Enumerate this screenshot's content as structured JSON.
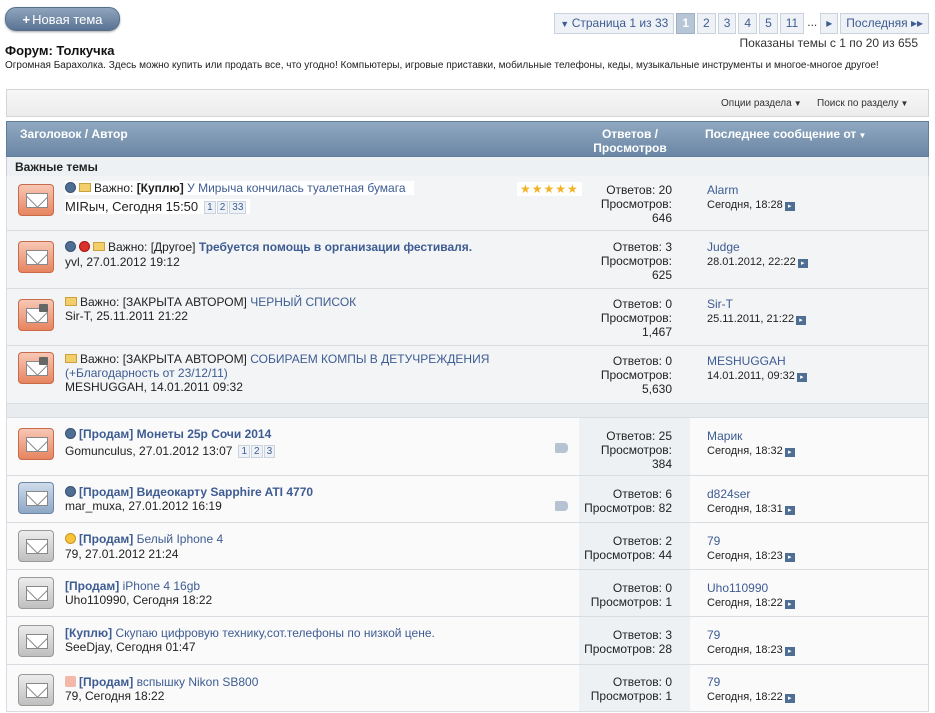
{
  "new_thread_label": "Новая тема",
  "pagenav": {
    "page_of": "Страница 1 из 33",
    "pages": [
      "1",
      "2",
      "3",
      "4",
      "5",
      "11"
    ],
    "dots": "...",
    "next": "▸",
    "last": "Последняя ▸▸"
  },
  "showing": "Показаны темы с 1 по 20 из 655",
  "forum": {
    "title": "Форум: Толкучка",
    "description": "Огромная Барахолка. Здесь можно купить или продать все, что угодно! Компьютеры, игровые приставки, мобильные телефоны, кеды, музыкальные инструменты и многое-многое другое!"
  },
  "options": {
    "section_options": "Опции раздела",
    "search_section": "Поиск по разделу"
  },
  "header": {
    "title_author": "Заголовок / Автор",
    "replies_views": "Ответов / Просмотров",
    "last_post": "Последнее сообщение от"
  },
  "sticky_label": "Важные темы",
  "threads": [
    {
      "prefix": "Важно:",
      "tag": "[Куплю]",
      "title": "У Мирыча кончилась туалетная бумага",
      "author": "MIRыч, Сегодня 15:50",
      "pages": [
        "1",
        "2",
        "33"
      ],
      "replies": "Ответов: 20",
      "views_label": "Просмотров:",
      "views": "646",
      "last_by": "Alarm",
      "last_time": "Сегодня, 18:28",
      "rating": "★★★★★"
    },
    {
      "prefix": "Важно:",
      "tag": "[Другое]",
      "title": "Требуется помощь в организации фестиваля.",
      "author": "yvl, 27.01.2012 19:12",
      "replies": "Ответов: 3",
      "views_label": "Просмотров:",
      "views": "625",
      "last_by": "Judge",
      "last_time": "28.01.2012, 22:22"
    },
    {
      "prefix": "Важно:",
      "tag": "[ЗАКРЫТА АВТОРОМ]",
      "title": "ЧЕРНЫЙ СПИСОК",
      "author": "Sir-T, 25.11.2011 21:22",
      "replies": "Ответов: 0",
      "views_label": "Просмотров:",
      "views": "1,467",
      "last_by": "Sir-T",
      "last_time": "25.11.2011, 21:22"
    },
    {
      "prefix": "Важно:",
      "tag": "[ЗАКРЫТА АВТОРОМ]",
      "title": "СОБИРАЕМ КОМПЫ В ДЕТУЧРЕЖДЕНИЯ",
      "title2": "(+Благодарность от 23/12/11)",
      "author": "MESHUGGAH, 14.01.2011 09:32",
      "replies": "Ответов: 0",
      "views_label": "Просмотров:",
      "views": "5,630",
      "last_by": "MESHUGGAH",
      "last_time": "14.01.2011, 09:32"
    },
    {
      "tag": "[Продам]",
      "title": "Монеты 25р Сочи 2014",
      "author": "Gomunculus, 27.01.2012 13:07",
      "pages": [
        "1",
        "2",
        "3"
      ],
      "replies": "Ответов: 25",
      "views_label": "Просмотров:",
      "views": "384",
      "last_by": "Марик",
      "last_time": "Сегодня, 18:32"
    },
    {
      "tag": "[Продам]",
      "title": "Видеокарту Sapphire ATI 4770",
      "author": "mar_muxa, 27.01.2012 16:19",
      "replies": "Ответов: 6",
      "views": "Просмотров: 82",
      "last_by": "d824ser",
      "last_time": "Сегодня, 18:31"
    },
    {
      "tag": "[Продам]",
      "title": "Белый Iphone 4",
      "author": "79, 27.01.2012 21:24",
      "replies": "Ответов: 2",
      "views": "Просмотров: 44",
      "last_by": "79",
      "last_time": "Сегодня, 18:23"
    },
    {
      "tag": "[Продам]",
      "title": "iPhone 4 16gb",
      "author": "Uho110990, Сегодня 18:22",
      "replies": "Ответов: 0",
      "views": "Просмотров: 1",
      "last_by": "Uho110990",
      "last_time": "Сегодня, 18:22"
    },
    {
      "tag": "[Куплю]",
      "title": "Скупаю цифровую технику,сот.телефоны по низкой цене.",
      "author": "SeeDjay, Сегодня 01:47",
      "replies": "Ответов: 3",
      "views": "Просмотров: 28",
      "last_by": "79",
      "last_time": "Сегодня, 18:23"
    },
    {
      "tag": "[Продам]",
      "title": "вспышку Nikon SB800",
      "author": "79, Сегодня 18:22",
      "replies": "Ответов: 0",
      "views": "Просмотров: 1",
      "last_by": "79",
      "last_time": "Сегодня, 18:22"
    }
  ],
  "colors": {
    "header_bg": "#7b96b3",
    "link": "#3e5c92",
    "hot_icon": "#e7845f",
    "star": "#f2b324"
  }
}
